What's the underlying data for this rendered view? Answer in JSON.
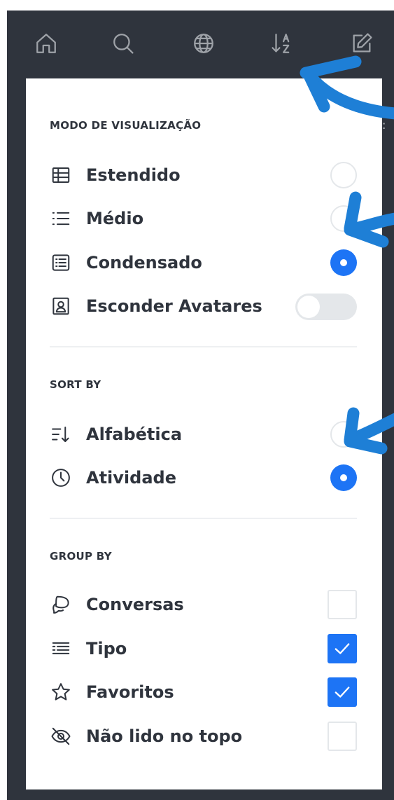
{
  "topbar": {
    "icons": [
      {
        "name": "home-icon",
        "label": "Home"
      },
      {
        "name": "search-icon",
        "label": "Search"
      },
      {
        "name": "globe-icon",
        "label": "Directory"
      },
      {
        "name": "sort-az-icon",
        "label": "Sort"
      },
      {
        "name": "compose-icon",
        "label": "Create new"
      }
    ]
  },
  "sections": {
    "view_mode": {
      "title": "MODO DE VISUALIZAÇÃO",
      "items": [
        {
          "label": "Estendido",
          "icon": "table-list-icon",
          "checked": false
        },
        {
          "label": "Médio",
          "icon": "list-icon",
          "checked": false
        },
        {
          "label": "Condensado",
          "icon": "condensed-list-icon",
          "checked": true
        }
      ],
      "toggle": {
        "label": "Esconder Avatares",
        "icon": "avatar-icon",
        "on": false
      }
    },
    "sort_by": {
      "title": "SORT BY",
      "items": [
        {
          "label": "Alfabética",
          "icon": "sort-alpha-icon",
          "checked": false
        },
        {
          "label": "Atividade",
          "icon": "clock-icon",
          "checked": true
        }
      ]
    },
    "group_by": {
      "title": "GROUP BY",
      "items": [
        {
          "label": "Conversas",
          "icon": "discussion-icon",
          "checked": false
        },
        {
          "label": "Tipo",
          "icon": "type-list-icon",
          "checked": true
        },
        {
          "label": "Favoritos",
          "icon": "star-icon",
          "checked": true
        },
        {
          "label": "Não lido no topo",
          "icon": "eye-off-icon",
          "checked": false
        }
      ]
    }
  },
  "colors": {
    "sidebar_bg": "#2f343d",
    "panel_bg": "#ffffff",
    "accent": "#1d74f5",
    "annotation_arrow": "#1e7fd6",
    "text": "#2f343d",
    "control_border": "#e4e7ea"
  }
}
